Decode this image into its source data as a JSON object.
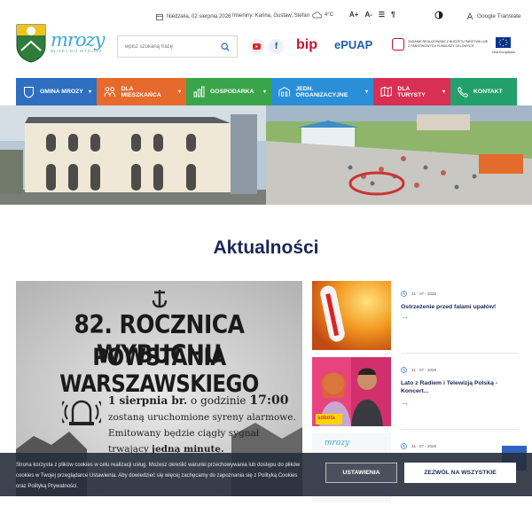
{
  "topbar": {
    "date": "Niedziela, 02 sierpnia 2026",
    "name_days": "Imieniny: Karina, Gustaw, Stefan",
    "temperature": "4°C",
    "font_up": "A+",
    "font_down": "A-",
    "translate": "Google Translate"
  },
  "logo": {
    "word": "mrozy",
    "tagline": "BLIŻEJ NIŻ MYŚLISZ"
  },
  "search": {
    "placeholder": "wpisz szukaną frazę"
  },
  "bip": {
    "label": "bip"
  },
  "epuap": {
    "label": "ePUAP"
  },
  "fund": {
    "text": "Zadanie realizowane z budżetu państwa lub z państwowych funduszy celowych"
  },
  "eu": {
    "label": "Unia Europejska"
  },
  "nav": [
    {
      "label": "GMINA MROZY",
      "color": "#2f6fbf",
      "icon": "shield-icon"
    },
    {
      "label": "DLA MIESZKAŃCA",
      "color": "#e66a2c",
      "icon": "people-icon"
    },
    {
      "label": "GOSPODARKA",
      "color": "#3aa44a",
      "icon": "chart-icon"
    },
    {
      "label": "JEDN. ORGANIZACYJNE",
      "color": "#2a8fd6",
      "icon": "building-icon"
    },
    {
      "label": "DLA TURYSTY",
      "color": "#d92f55",
      "icon": "map-icon"
    },
    {
      "label": "KONTAKT",
      "color": "#22a06b",
      "icon": "phone-icon"
    }
  ],
  "news_section": {
    "heading": "Aktualności"
  },
  "featured": {
    "line1": "82. ROCZNICA WYBUCHU",
    "line2": "POWSTANIA WARSZAWSKIEGO",
    "text1_pre": "1 sierpnia br.",
    "text1_mid": "o godzinie",
    "text1_time": "17:00",
    "text2": "zostaną uruchomione syreny alarmowe.",
    "text3": "Emitowany będzie ciągły sygnał",
    "text4_pre": "trwający",
    "text4_bold": "jedną minutę."
  },
  "news": [
    {
      "date": "31 - 07 - 2026",
      "title": "Ostrzeżenie przed falami upałów!"
    },
    {
      "date": "31 - 07 - 2026",
      "title": "Lato z Radiem i Telewizją Polską - Koncert..."
    },
    {
      "date": "31 - 07 - 2026",
      "title": ""
    }
  ],
  "news_thumb": {
    "day": "sobota",
    "logo": "mrozy"
  },
  "cookie": {
    "message": "Strona korzysta z plików cookies w celu realizacji usług. Możesz określić warunki przechowywania lub dostępu do plików cookies w Twojej przeglądarce Ustawienia. Aby dowiedzieć się więcej zachęcamy do zapoznania się z Polityką Cookies oraz Polityką Prywatności.",
    "settings_label": "USTAWIENIA",
    "accept_label": "ZEZWÓL NA WSZYSTKIE"
  }
}
